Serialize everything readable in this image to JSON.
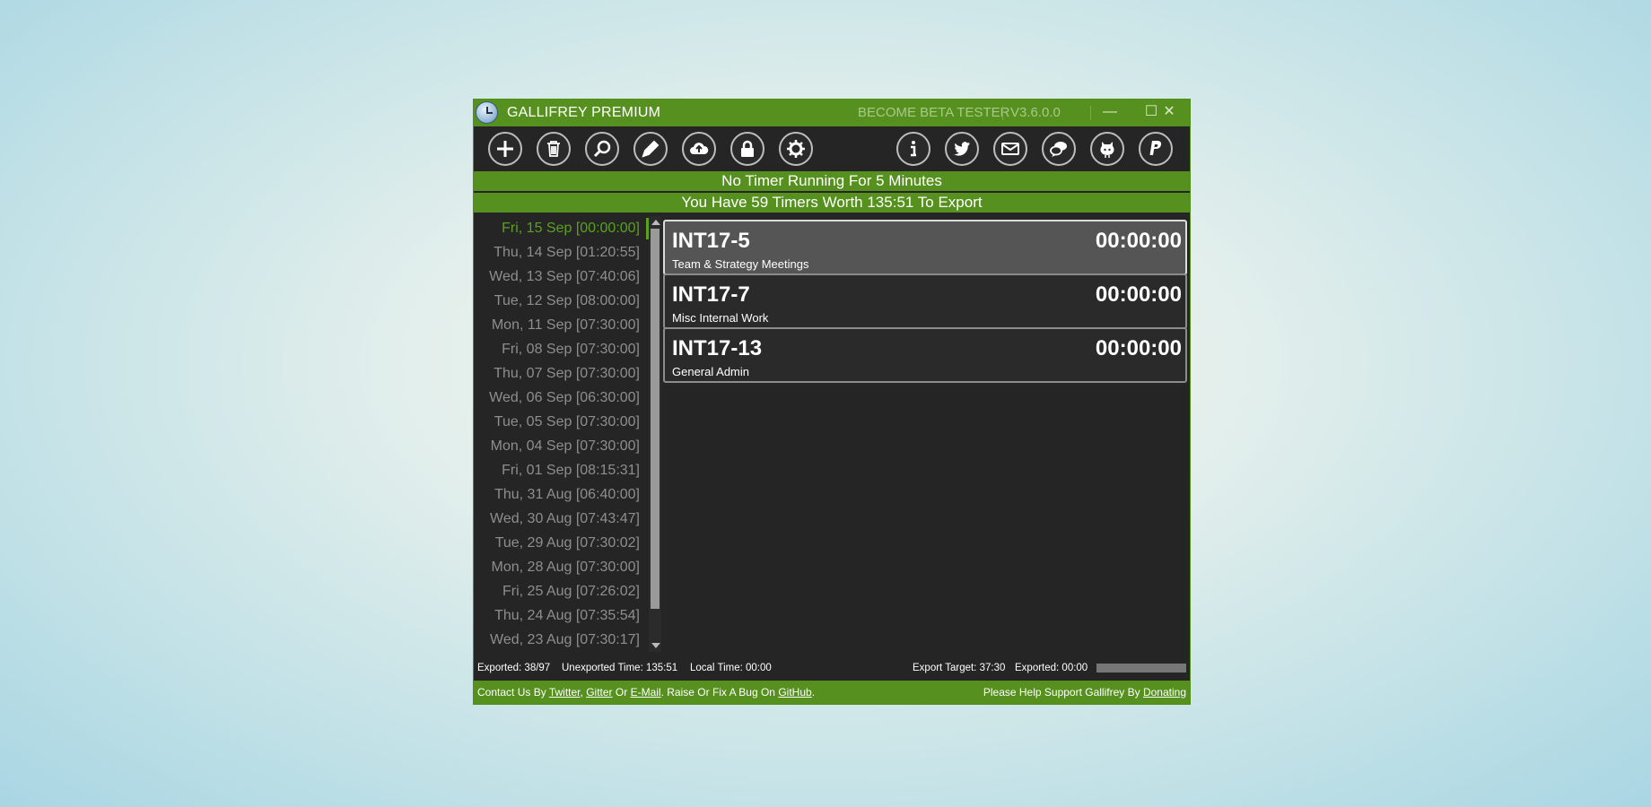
{
  "window": {
    "title": "GALLIFREY PREMIUM",
    "beta_link": "BECOME BETA TESTER",
    "version": "V3.6.0.0",
    "minimize_glyph": "—",
    "maximize_glyph": "☐",
    "close_glyph": "✕"
  },
  "toolbar": {
    "left": [
      "add-icon",
      "delete-icon",
      "search-icon",
      "edit-icon",
      "cloud-upload-icon",
      "lock-icon",
      "settings-icon"
    ],
    "right": [
      "info-icon",
      "twitter-icon",
      "email-icon",
      "chat-icon",
      "github-icon",
      "paypal-icon"
    ]
  },
  "banners": {
    "running": "No Timer Running For 5 Minutes",
    "export": "You Have 59 Timers Worth 135:51 To Export"
  },
  "dates": [
    {
      "label": "Fri, 15 Sep [00:00:00]",
      "active": true
    },
    {
      "label": "Thu, 14 Sep [01:20:55]"
    },
    {
      "label": "Wed, 13 Sep [07:40:06]"
    },
    {
      "label": "Tue, 12 Sep [08:00:00]"
    },
    {
      "label": "Mon, 11 Sep [07:30:00]"
    },
    {
      "label": "Fri, 08 Sep [07:30:00]"
    },
    {
      "label": "Thu, 07 Sep [07:30:00]"
    },
    {
      "label": "Wed, 06 Sep [06:30:00]"
    },
    {
      "label": "Tue, 05 Sep [07:30:00]"
    },
    {
      "label": "Mon, 04 Sep [07:30:00]"
    },
    {
      "label": "Fri, 01 Sep [08:15:31]"
    },
    {
      "label": "Thu, 31 Aug [06:40:00]"
    },
    {
      "label": "Wed, 30 Aug [07:43:47]"
    },
    {
      "label": "Tue, 29 Aug [07:30:02]"
    },
    {
      "label": "Mon, 28 Aug [07:30:00]"
    },
    {
      "label": "Fri, 25 Aug [07:26:02]"
    },
    {
      "label": "Thu, 24 Aug [07:35:54]"
    },
    {
      "label": "Wed, 23 Aug [07:30:17]"
    }
  ],
  "timers": [
    {
      "code": "INT17-5",
      "time": "00:00:00",
      "desc": "Team & Strategy Meetings",
      "selected": true
    },
    {
      "code": "INT17-7",
      "time": "00:00:00",
      "desc": "Misc Internal Work"
    },
    {
      "code": "INT17-13",
      "time": "00:00:00",
      "desc": "General Admin"
    }
  ],
  "status": {
    "exported": "Exported: 38/97",
    "unexported": "Unexported Time: 135:51",
    "local_time": "Local Time: 00:00",
    "export_target": "Export Target: 37:30",
    "exported_time": "Exported: 00:00",
    "progress": 0
  },
  "footer": {
    "contact_prefix": "Contact Us By",
    "twitter": "Twitter",
    "comma": ",",
    "gitter": "Gitter",
    "or": "Or",
    "email": "E-Mail",
    "raise": ". Raise Or Fix A Bug On",
    "github": "GitHub",
    "period": ".",
    "support_prefix": "Please Help Support Gallifrey By",
    "donating": "Donating"
  },
  "colors": {
    "accent": "#56901e",
    "active_date": "#5aa21e",
    "background": "#252525"
  }
}
